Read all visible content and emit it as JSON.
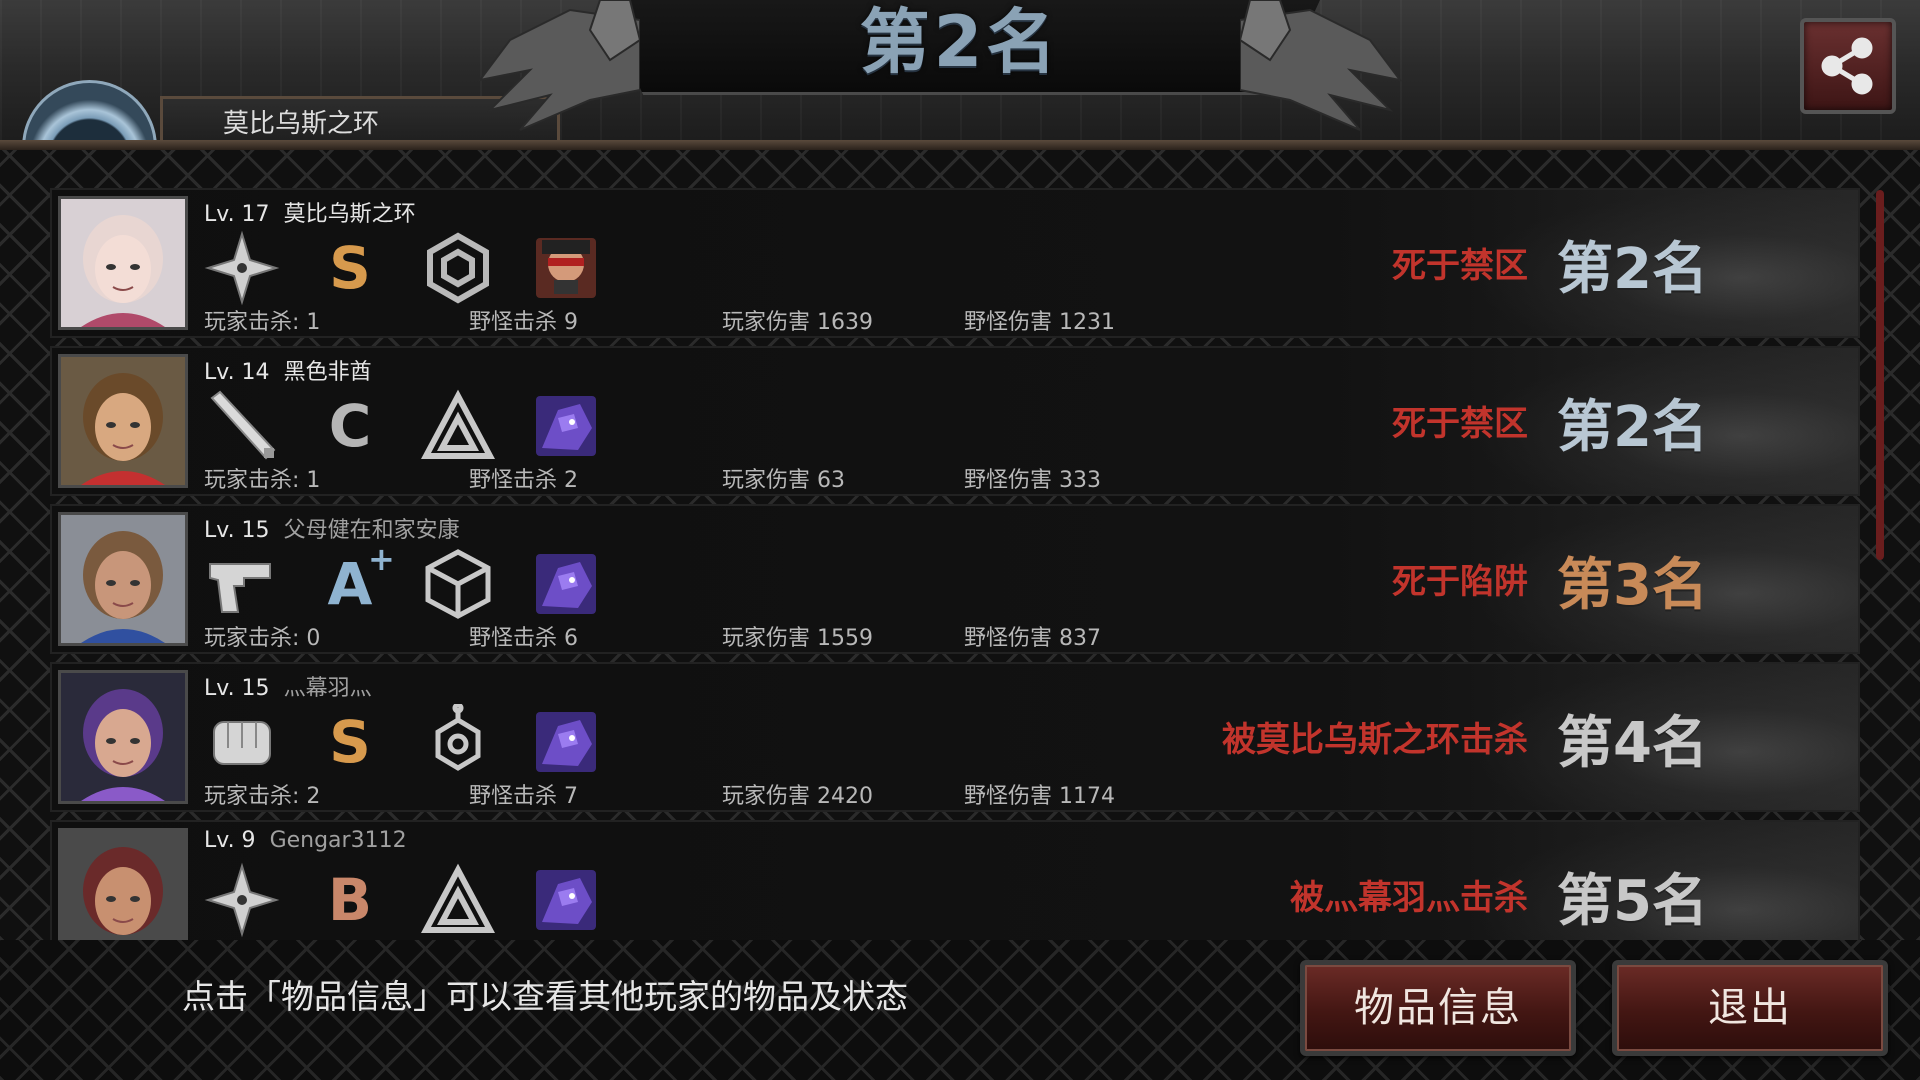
{
  "header": {
    "title": "第2名",
    "player_tab": "莫比乌斯之环",
    "share_icon": "share-icon"
  },
  "players": [
    {
      "level": "Lv. 17",
      "name": "莫比乌斯之环",
      "weapon_icon": "shuriken-icon",
      "grade": "S",
      "grade_color": "#d79a4d",
      "item_icon": "hexagon-link-icon",
      "pet_icon": "red-masked-creature-icon",
      "player_kills": "玩家击杀: 1",
      "monster_kills": "野怪击杀 9",
      "player_damage": "玩家伤害 1639",
      "monster_damage": "野怪伤害 1231",
      "death": "死于禁区",
      "rank": "第2名",
      "rank_color": "#b8c7d3"
    },
    {
      "level": "Lv. 14",
      "name": "黑色非酋",
      "weapon_icon": "baseball-bat-icon",
      "grade": "C",
      "grade_color": "#b5b5b5",
      "item_icon": "triangle-icon",
      "pet_icon": "purple-creature-icon",
      "player_kills": "玩家击杀: 1",
      "monster_kills": "野怪击杀 2",
      "player_damage": "玩家伤害 63",
      "monster_damage": "野怪伤害 333",
      "death": "死于禁区",
      "rank": "第2名",
      "rank_color": "#b8c7d3"
    },
    {
      "level": "Lv. 15",
      "name": "父母健在和家安康",
      "weapon_icon": "pistol-icon",
      "grade": "A",
      "grade_plus": "+",
      "grade_color": "#8fb3d0",
      "item_icon": "cube-icon",
      "pet_icon": "purple-creature-icon",
      "player_kills": "玩家击杀: 0",
      "monster_kills": "野怪击杀 6",
      "player_damage": "玩家伤害 1559",
      "monster_damage": "野怪伤害 837",
      "death": "死于陷阱",
      "rank": "第3名",
      "rank_color": "#c88a58"
    },
    {
      "level": "Lv. 15",
      "name": "灬幕羽灬",
      "weapon_icon": "fist-icon",
      "grade": "S",
      "grade_color": "#d79a4d",
      "item_icon": "hexagon-node-icon",
      "pet_icon": "purple-creature-icon",
      "player_kills": "玩家击杀: 2",
      "monster_kills": "野怪击杀 7",
      "player_damage": "玩家伤害 2420",
      "monster_damage": "野怪伤害 1174",
      "death": "被莫比乌斯之环击杀",
      "rank": "第4名",
      "rank_color": "#c8c8c8"
    },
    {
      "level": "Lv. 9",
      "name": "Gengar3112",
      "weapon_icon": "shuriken-icon",
      "grade": "B",
      "grade_color": "#c9876a",
      "item_icon": "triangle-icon",
      "pet_icon": "purple-creature-icon",
      "player_kills": "",
      "monster_kills": "",
      "player_damage": "",
      "monster_damage": "",
      "death": "被灬幕羽灬击杀",
      "rank": "第5名",
      "rank_color": "#c8c8c8"
    }
  ],
  "footer": {
    "hint": "点击「物品信息」可以查看其他玩家的物品及状态",
    "items_button": "物品信息",
    "exit_button": "退出"
  }
}
